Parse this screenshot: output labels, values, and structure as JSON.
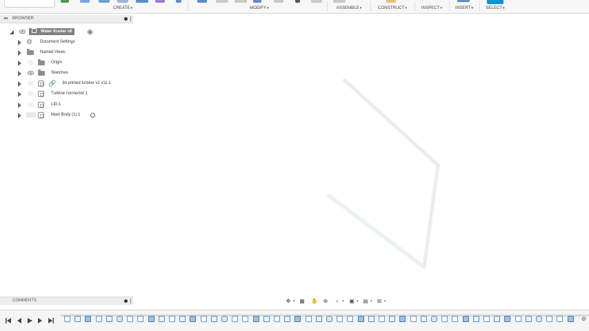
{
  "toolbar": {
    "groups": [
      {
        "label": "CREATE",
        "caret": "▾"
      },
      {
        "label": "MODIFY",
        "caret": "▾"
      },
      {
        "label": "ASSEMBLE",
        "caret": "▾"
      },
      {
        "label": "CONSTRUCT",
        "caret": "▾"
      },
      {
        "label": "INSPECT",
        "caret": "▾"
      },
      {
        "label": "INSERT",
        "caret": "▾"
      },
      {
        "label": "SELECT",
        "caret": "▾"
      }
    ]
  },
  "browser": {
    "title": "BROWSER",
    "collapse_glyph": "◂◂",
    "root": {
      "label": "Water Kooler v6"
    },
    "items": [
      {
        "label": "Document Settings",
        "icon": "gear-icon"
      },
      {
        "label": "Named Views",
        "icon": "folder-icon"
      },
      {
        "label": "Origin",
        "icon": "folder-icon"
      },
      {
        "label": "Sketches",
        "icon": "folder-icon"
      },
      {
        "label": "3d printed turbine v2 v11:1",
        "icon": "linked-component-icon"
      },
      {
        "label": "Turbine connector:1",
        "icon": "component-icon"
      },
      {
        "label": "LID:1",
        "icon": "component-icon"
      },
      {
        "label": "Main Body (1):1",
        "icon": "component-icon"
      }
    ]
  },
  "comments": {
    "title": "COMMENTS"
  },
  "navbar": {
    "icons": [
      "orbit-icon",
      "look-at-icon",
      "pan-icon",
      "zoom-icon",
      "fit-icon",
      "display-settings-icon",
      "grid-settings-icon",
      "viewports-icon"
    ]
  },
  "timeline": {
    "controls": [
      "go-to-start-icon",
      "step-back-icon",
      "play-icon",
      "step-forward-icon",
      "go-to-end-icon"
    ]
  },
  "colors": {
    "accent": "#0696d7",
    "feature_blue": "#4a8ac9",
    "panel_bg": "#ececec"
  }
}
